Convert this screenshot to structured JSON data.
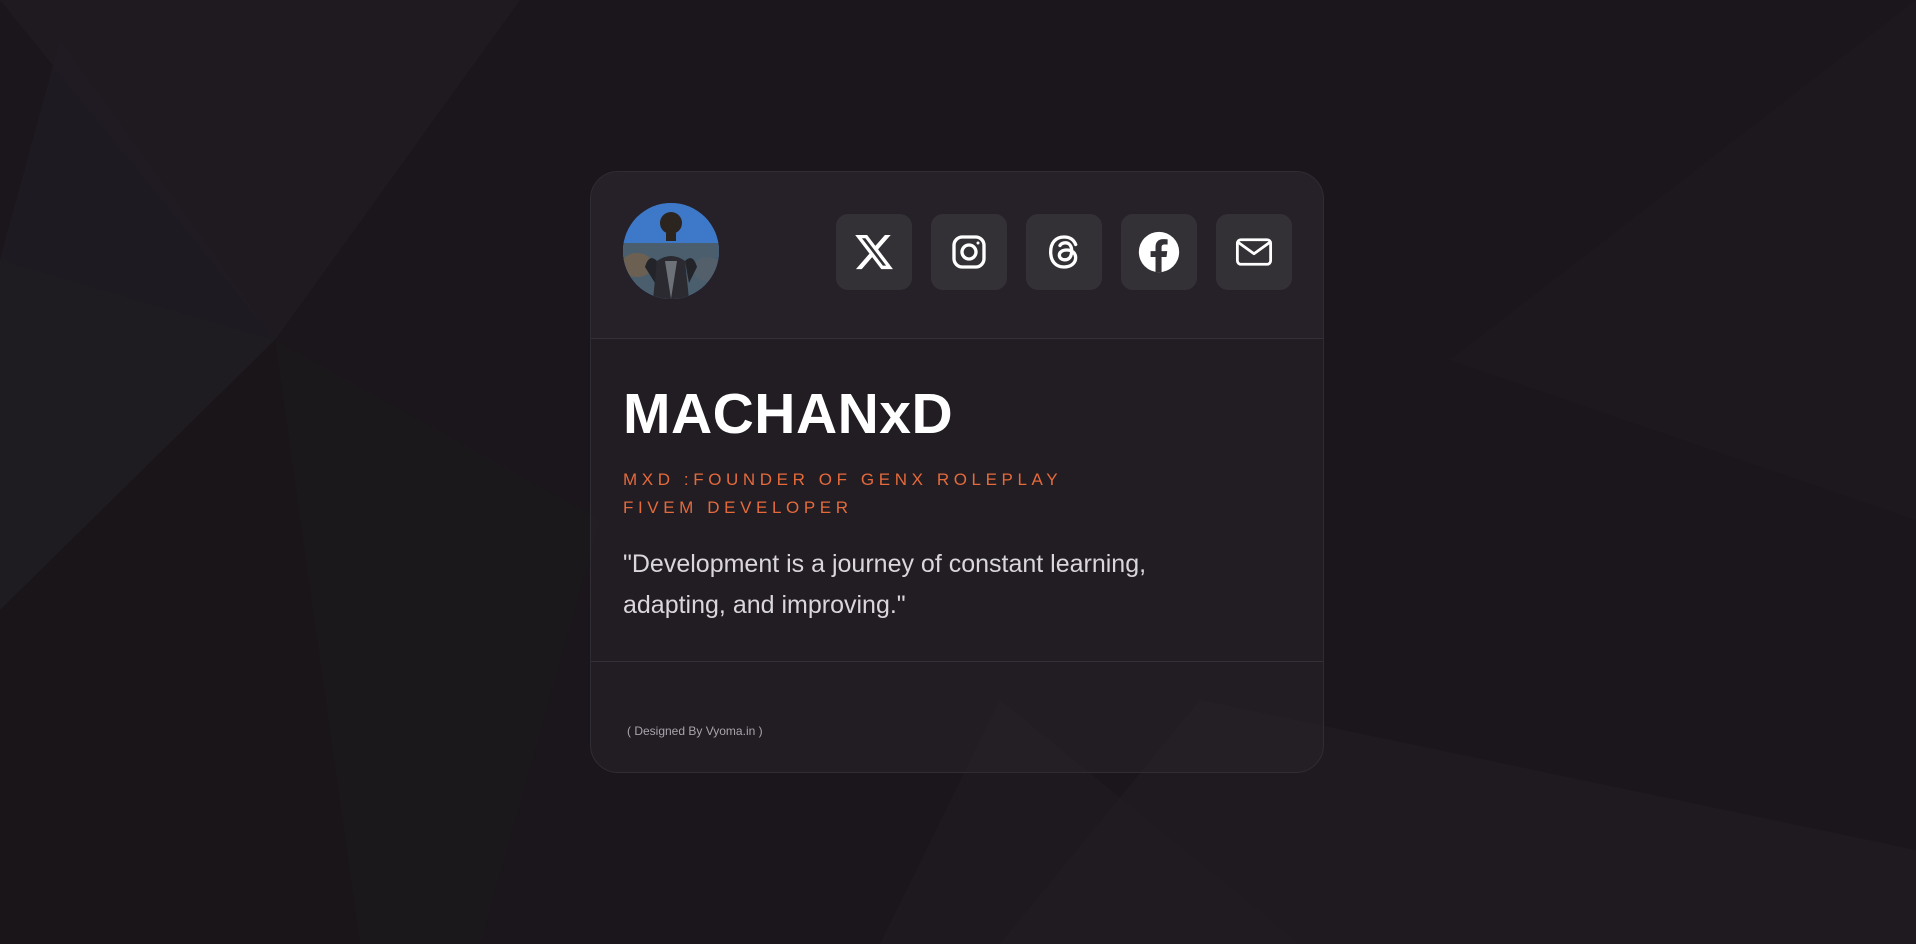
{
  "colors": {
    "background": "#1a161b",
    "card_border": "#302c33",
    "social_button_bg": "#333036",
    "name_text": "#ffffff",
    "role_text": "#e46a3c",
    "quote_text": "#d9d6dc",
    "credit_text": "#a8a4ac"
  },
  "profile": {
    "avatar_icon": "profile-photo",
    "name": "MACHANxD",
    "role_line_1": "MXD :FOUNDER OF GENX ROLEPLAY",
    "role_line_2": "FIVEM DEVELOPER",
    "quote": "\"Development is a journey of constant learning, adapting, and improving.\""
  },
  "socials": [
    {
      "icon": "x-twitter-icon"
    },
    {
      "icon": "instagram-icon"
    },
    {
      "icon": "threads-icon"
    },
    {
      "icon": "facebook-icon"
    },
    {
      "icon": "mail-icon"
    }
  ],
  "footer": {
    "credit": "( Designed By Vyoma.in )"
  }
}
